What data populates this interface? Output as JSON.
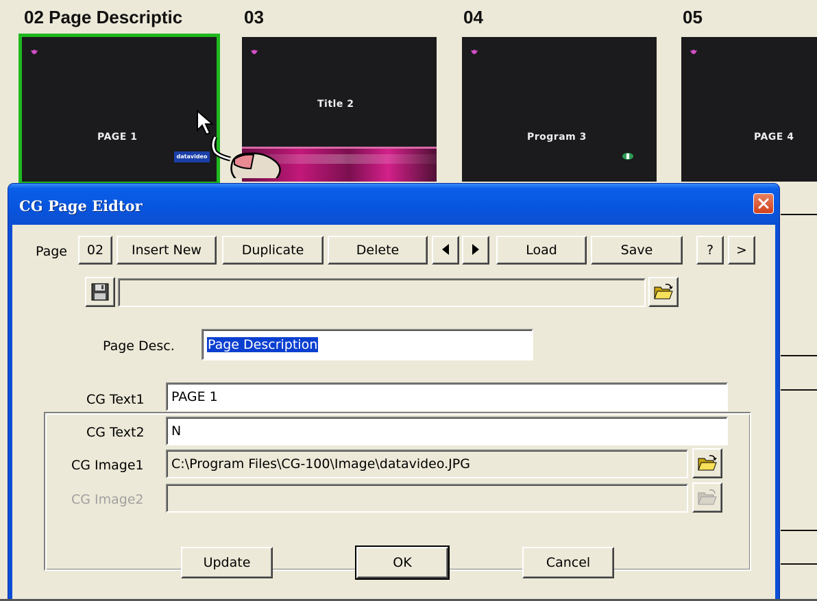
{
  "thumbnails": [
    {
      "header": "02 Page Descriptic",
      "label": "PAGE 1",
      "logo": "datavideo"
    },
    {
      "header": "03",
      "label": "Title 2"
    },
    {
      "header": "04",
      "label": "Program 3"
    },
    {
      "header": "05",
      "label": "PAGE 4"
    }
  ],
  "colors": {
    "selected_outline": "#1fb81f",
    "titlebar": "#0856e0",
    "dialog_bg": "#ece9d8"
  },
  "dialog": {
    "title": "CG Page Eidtor",
    "toolbar": {
      "page_label": "Page",
      "page_value": "02",
      "insert_new": "Insert New",
      "duplicate": "Duplicate",
      "delete": "Delete",
      "load": "Load",
      "save": "Save",
      "help": "?",
      "more": ">"
    },
    "file_path": "",
    "page_desc": {
      "label": "Page Desc.",
      "value": "Page Description"
    },
    "fields": [
      {
        "label": "CG Text1",
        "value": "PAGE 1"
      },
      {
        "label": "CG Text2",
        "value": "N"
      },
      {
        "label": "CG Image1",
        "value": "C:\\Program Files\\CG-100\\Image\\datavideo.JPG"
      },
      {
        "label": "CG Image2",
        "value": ""
      }
    ],
    "buttons": {
      "update": "Update",
      "ok": "OK",
      "cancel": "Cancel"
    }
  }
}
